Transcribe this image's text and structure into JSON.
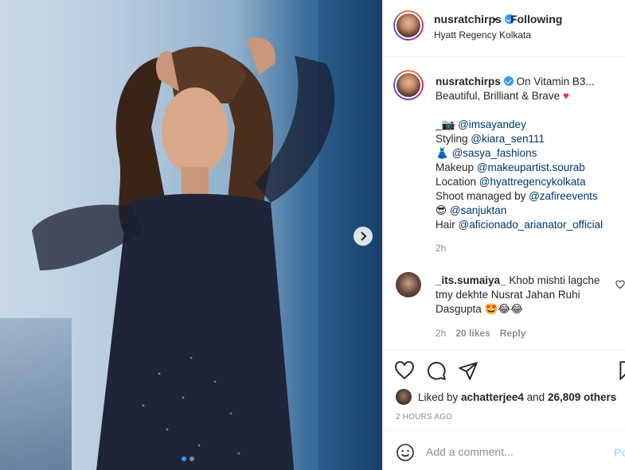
{
  "header": {
    "username": "nusratchirps",
    "separator": "•",
    "follow_label": "Following",
    "location": "Hyatt Regency Kolkata"
  },
  "caption": {
    "username": "nusratchirps",
    "line1": "On Vitamin B3...",
    "line2": "Beautiful, Brilliant & Brave",
    "line2_emoji": "♥",
    "credits": [
      {
        "prefix": "_📷 ",
        "mention": "@imsayandey"
      },
      {
        "prefix": "Styling ",
        "mention": "@kiara_sen111"
      },
      {
        "prefix": "👗 ",
        "mention": "@sasya_fashions"
      },
      {
        "prefix": "Makeup ",
        "mention": "@makeupartist.sourab"
      },
      {
        "prefix": "Location ",
        "mention": "@hyattregencykolkata"
      },
      {
        "prefix": "Shoot managed by ",
        "mention": "@zafireevents"
      },
      {
        "prefix": "😎 ",
        "mention": "@sanjuktan"
      },
      {
        "prefix": "Hair ",
        "mention": "@aficionado_arianator_official"
      }
    ],
    "time": "2h"
  },
  "comment": {
    "username": "_its.sumaiya_",
    "text": "Khob mishti lagche tmy dekhte Nusrat Jahan Ruhi Dasgupta 🤩😂😂",
    "time": "2h",
    "likes": "20 likes",
    "reply_label": "Reply"
  },
  "likes": {
    "prefix": "Liked by",
    "user": "achatterjee4",
    "middle": "and",
    "count": "26,809 others"
  },
  "posted_ago": "2 HOURS AGO",
  "add_comment": {
    "placeholder": "Add a comment...",
    "post_label": "Post"
  },
  "carousel": {
    "total": 2,
    "active": 1
  },
  "colors": {
    "accent": "#3897f0",
    "mention": "#00376b",
    "heart": "#ed2c38",
    "muted": "#8e8e8e"
  },
  "icons": [
    "chevron-right-icon",
    "verified-badge-icon",
    "heart-icon",
    "comment-icon",
    "share-icon",
    "bookmark-icon",
    "emoji-icon"
  ]
}
